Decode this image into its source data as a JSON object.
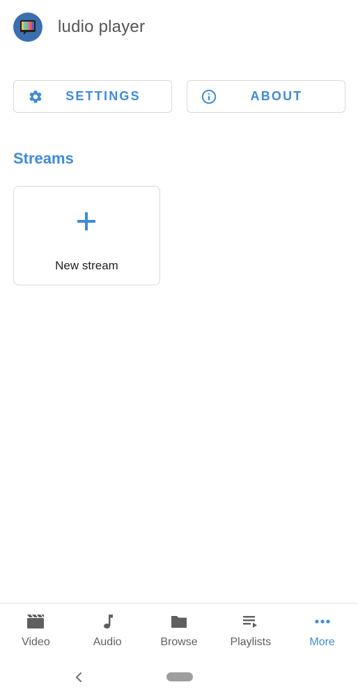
{
  "header": {
    "title": "ludio player",
    "logo_icon": "tv-logo-icon"
  },
  "actions": {
    "settings_label": "SETTINGS",
    "settings_icon": "gear-icon",
    "about_label": "ABOUT",
    "about_icon": "info-icon"
  },
  "streams": {
    "section_title": "Streams",
    "new_stream_label": "New stream",
    "new_stream_icon": "plus-icon"
  },
  "bottom_nav": {
    "items": [
      {
        "label": "Video",
        "icon": "clapperboard-icon",
        "active": false
      },
      {
        "label": "Audio",
        "icon": "music-note-icon",
        "active": false
      },
      {
        "label": "Browse",
        "icon": "folder-icon",
        "active": false
      },
      {
        "label": "Playlists",
        "icon": "playlist-icon",
        "active": false
      },
      {
        "label": "More",
        "icon": "more-dots-icon",
        "active": true
      }
    ]
  },
  "colors": {
    "accent": "#3d8bd9",
    "text_muted": "#5f5f5f",
    "border": "#d9d9d9"
  }
}
